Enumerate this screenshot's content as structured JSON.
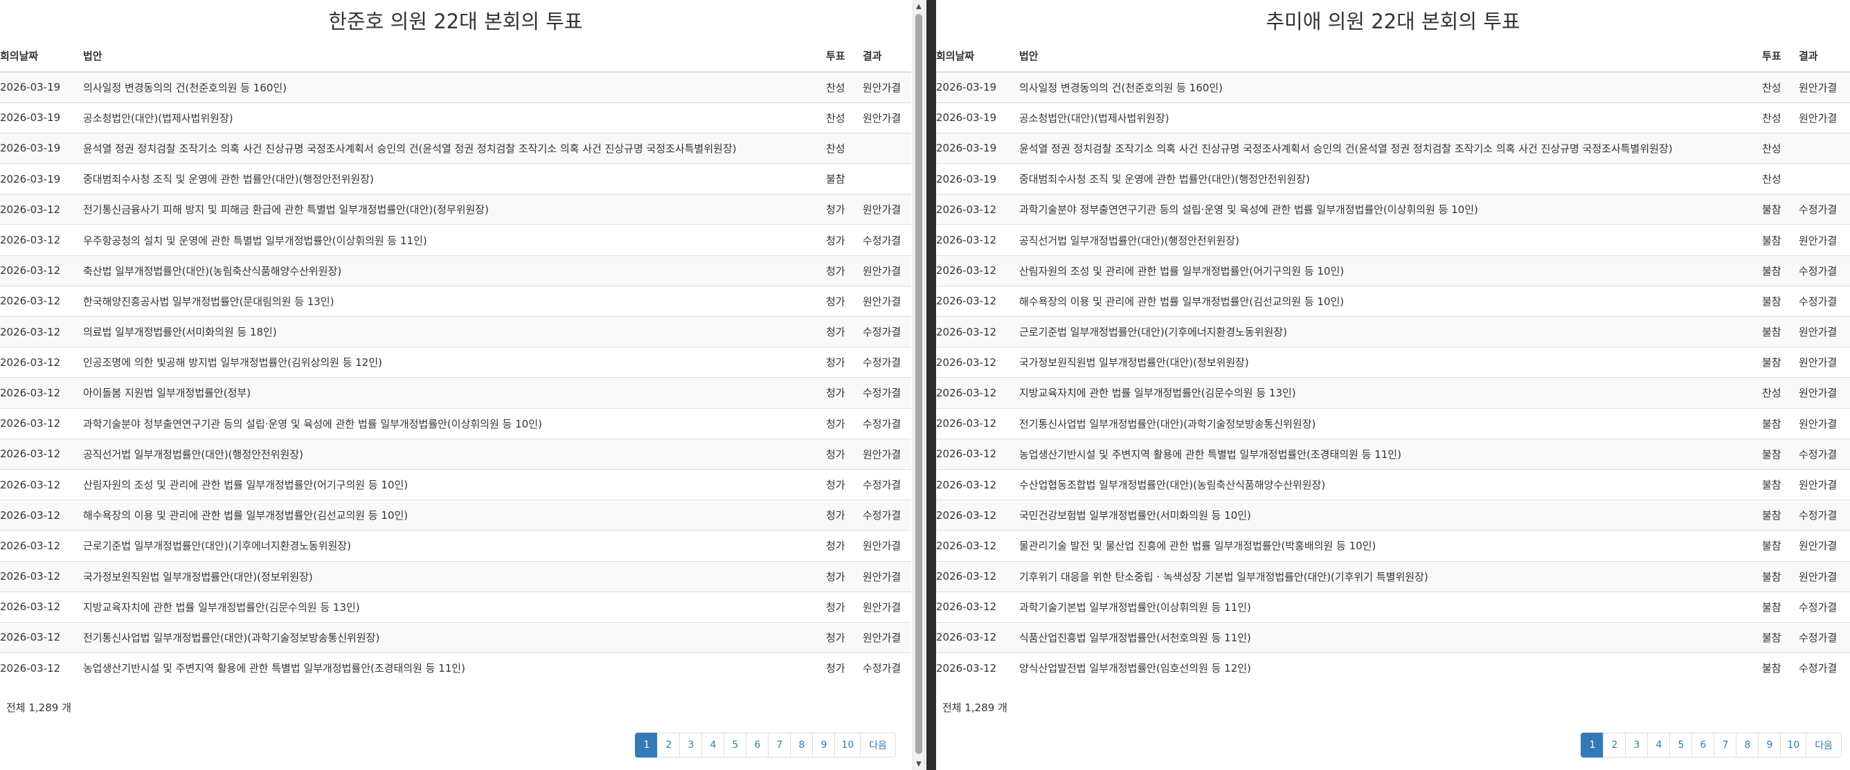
{
  "left": {
    "title": "한준호 의원 22대 본회의 투표",
    "headers": {
      "date": "회의날짜",
      "bill": "법안",
      "vote": "투표",
      "result": "결과"
    },
    "rows": [
      {
        "date": "2026-03-19",
        "bill": "의사일정 변경동의의 건(천준호의원 등 160인)",
        "vote": "찬성",
        "result": "원안가결"
      },
      {
        "date": "2026-03-19",
        "bill": "공소청법안(대안)(법제사법위원장)",
        "vote": "찬성",
        "result": "원안가결"
      },
      {
        "date": "2026-03-19",
        "bill": "윤석열 정권 정치검찰 조작기소 의혹 사건 진상규명 국정조사계획서 승인의 건(윤석열 정권 정치검찰 조작기소 의혹 사건 진상규명 국정조사특별위원장)",
        "vote": "찬성",
        "result": ""
      },
      {
        "date": "2026-03-19",
        "bill": "중대범죄수사청 조직 및 운영에 관한 법률안(대안)(행정안전위원장)",
        "vote": "불참",
        "result": ""
      },
      {
        "date": "2026-03-12",
        "bill": "전기통신금융사기 피해 방지 및 피해금 환급에 관한 특별법 일부개정법률안(대안)(정무위원장)",
        "vote": "청가",
        "result": "원안가결"
      },
      {
        "date": "2026-03-12",
        "bill": "우주항공청의 설치 및 운영에 관한 특별법 일부개정법률안(이상휘의원 등 11인)",
        "vote": "청가",
        "result": "수정가결"
      },
      {
        "date": "2026-03-12",
        "bill": "축산법 일부개정법률안(대안)(농림축산식품해양수산위원장)",
        "vote": "청가",
        "result": "원안가결"
      },
      {
        "date": "2026-03-12",
        "bill": "한국해양진흥공사법 일부개정법률안(문대림의원 등 13인)",
        "vote": "청가",
        "result": "원안가결"
      },
      {
        "date": "2026-03-12",
        "bill": "의료법 일부개정법률안(서미화의원 등 18인)",
        "vote": "청가",
        "result": "수정가결"
      },
      {
        "date": "2026-03-12",
        "bill": "인공조명에 의한 빛공해 방지법 일부개정법률안(김위상의원 등 12인)",
        "vote": "청가",
        "result": "수정가결"
      },
      {
        "date": "2026-03-12",
        "bill": "아이돌봄 지원법 일부개정법률안(정부)",
        "vote": "청가",
        "result": "수정가결"
      },
      {
        "date": "2026-03-12",
        "bill": "과학기술분야 정부출연연구기관 등의 설립·운영 및 육성에 관한 법률 일부개정법률안(이상휘의원 등 10인)",
        "vote": "청가",
        "result": "수정가결"
      },
      {
        "date": "2026-03-12",
        "bill": "공직선거법 일부개정법률안(대안)(행정안전위원장)",
        "vote": "청가",
        "result": "원안가결"
      },
      {
        "date": "2026-03-12",
        "bill": "산림자원의 조성 및 관리에 관한 법률 일부개정법률안(어기구의원 등 10인)",
        "vote": "청가",
        "result": "수정가결"
      },
      {
        "date": "2026-03-12",
        "bill": "해수욕장의 이용 및 관리에 관한 법률 일부개정법률안(김선교의원 등 10인)",
        "vote": "청가",
        "result": "수정가결"
      },
      {
        "date": "2026-03-12",
        "bill": "근로기준법 일부개정법률안(대안)(기후에너지환경노동위원장)",
        "vote": "청가",
        "result": "원안가결"
      },
      {
        "date": "2026-03-12",
        "bill": "국가정보원직원법 일부개정법률안(대안)(정보위원장)",
        "vote": "청가",
        "result": "원안가결"
      },
      {
        "date": "2026-03-12",
        "bill": "지방교육자치에 관한 법률 일부개정법률안(김문수의원 등 13인)",
        "vote": "청가",
        "result": "원안가결"
      },
      {
        "date": "2026-03-12",
        "bill": "전기통신사업법 일부개정법률안(대안)(과학기술정보방송통신위원장)",
        "vote": "청가",
        "result": "원안가결"
      },
      {
        "date": "2026-03-12",
        "bill": "농업생산기반시설 및 주변지역 활용에 관한 특별법 일부개정법률안(조경태의원 등 11인)",
        "vote": "청가",
        "result": "수정가결"
      }
    ],
    "total": "전체 1,289 개",
    "pages": [
      "1",
      "2",
      "3",
      "4",
      "5",
      "6",
      "7",
      "8",
      "9",
      "10"
    ],
    "next_label": "다음"
  },
  "right": {
    "title": "추미애 의원 22대 본회의 투표",
    "headers": {
      "date": "회의날짜",
      "bill": "법안",
      "vote": "투표",
      "result": "결과"
    },
    "rows": [
      {
        "date": "2026-03-19",
        "bill": "의사일정 변경동의의 건(천준호의원 등 160인)",
        "vote": "찬성",
        "result": "원안가결"
      },
      {
        "date": "2026-03-19",
        "bill": "공소청법안(대안)(법제사법위원장)",
        "vote": "찬성",
        "result": "원안가결"
      },
      {
        "date": "2026-03-19",
        "bill": "윤석열 정권 정치검찰 조작기소 의혹 사건 진상규명 국정조사계획서 승인의 건(윤석열 정권 정치검찰 조작기소 의혹 사건 진상규명 국정조사특별위원장)",
        "vote": "찬성",
        "result": ""
      },
      {
        "date": "2026-03-19",
        "bill": "중대범죄수사청 조직 및 운영에 관한 법률안(대안)(행정안전위원장)",
        "vote": "찬성",
        "result": ""
      },
      {
        "date": "2026-03-12",
        "bill": "과학기술분야 정부출연연구기관 등의 설립·운영 및 육성에 관한 법률 일부개정법률안(이상휘의원 등 10인)",
        "vote": "불참",
        "result": "수정가결"
      },
      {
        "date": "2026-03-12",
        "bill": "공직선거법 일부개정법률안(대안)(행정안전위원장)",
        "vote": "불참",
        "result": "원안가결"
      },
      {
        "date": "2026-03-12",
        "bill": "산림자원의 조성 및 관리에 관한 법률 일부개정법률안(어기구의원 등 10인)",
        "vote": "불참",
        "result": "수정가결"
      },
      {
        "date": "2026-03-12",
        "bill": "해수욕장의 이용 및 관리에 관한 법률 일부개정법률안(김선교의원 등 10인)",
        "vote": "불참",
        "result": "수정가결"
      },
      {
        "date": "2026-03-12",
        "bill": "근로기준법 일부개정법률안(대안)(기후에너지환경노동위원장)",
        "vote": "불참",
        "result": "원안가결"
      },
      {
        "date": "2026-03-12",
        "bill": "국가정보원직원법 일부개정법률안(대안)(정보위원장)",
        "vote": "불참",
        "result": "원안가결"
      },
      {
        "date": "2026-03-12",
        "bill": "지방교육자치에 관한 법률 일부개정법률안(김문수의원 등 13인)",
        "vote": "찬성",
        "result": "원안가결"
      },
      {
        "date": "2026-03-12",
        "bill": "전기통신사업법 일부개정법률안(대안)(과학기술정보방송통신위원장)",
        "vote": "불참",
        "result": "원안가결"
      },
      {
        "date": "2026-03-12",
        "bill": "농업생산기반시설 및 주변지역 활용에 관한 특별법 일부개정법률안(조경태의원 등 11인)",
        "vote": "불참",
        "result": "수정가결"
      },
      {
        "date": "2026-03-12",
        "bill": "수산업협동조합법 일부개정법률안(대안)(농림축산식품해양수산위원장)",
        "vote": "불참",
        "result": "원안가결"
      },
      {
        "date": "2026-03-12",
        "bill": "국민건강보험법 일부개정법률안(서미화의원 등 10인)",
        "vote": "불참",
        "result": "수정가결"
      },
      {
        "date": "2026-03-12",
        "bill": "물관리기술 발전 및 물산업 진흥에 관한 법률 일부개정법률안(박홍배의원 등 10인)",
        "vote": "불참",
        "result": "원안가결"
      },
      {
        "date": "2026-03-12",
        "bill": "기후위기 대응을 위한 탄소중립 · 녹색성장 기본법 일부개정법률안(대안)(기후위기 특별위원장)",
        "vote": "불참",
        "result": "원안가결"
      },
      {
        "date": "2026-03-12",
        "bill": "과학기술기본법 일부개정법률안(이상휘의원 등 11인)",
        "vote": "불참",
        "result": "수정가결"
      },
      {
        "date": "2026-03-12",
        "bill": "식품산업진흥법 일부개정법률안(서천호의원 등 11인)",
        "vote": "불참",
        "result": "수정가결"
      },
      {
        "date": "2026-03-12",
        "bill": "양식산업발전법 일부개정법률안(임호선의원 등 12인)",
        "vote": "불참",
        "result": "수정가결"
      }
    ],
    "total": "전체 1,289 개",
    "pages": [
      "1",
      "2",
      "3",
      "4",
      "5",
      "6",
      "7",
      "8",
      "9",
      "10"
    ],
    "next_label": "다음"
  },
  "scrollbar": {
    "up_arrow": "▲",
    "down_arrow": "▼"
  },
  "colors": {
    "accent": "#337ab7",
    "divider": "#2b2b2b",
    "stripe": "#f9f9f9"
  }
}
